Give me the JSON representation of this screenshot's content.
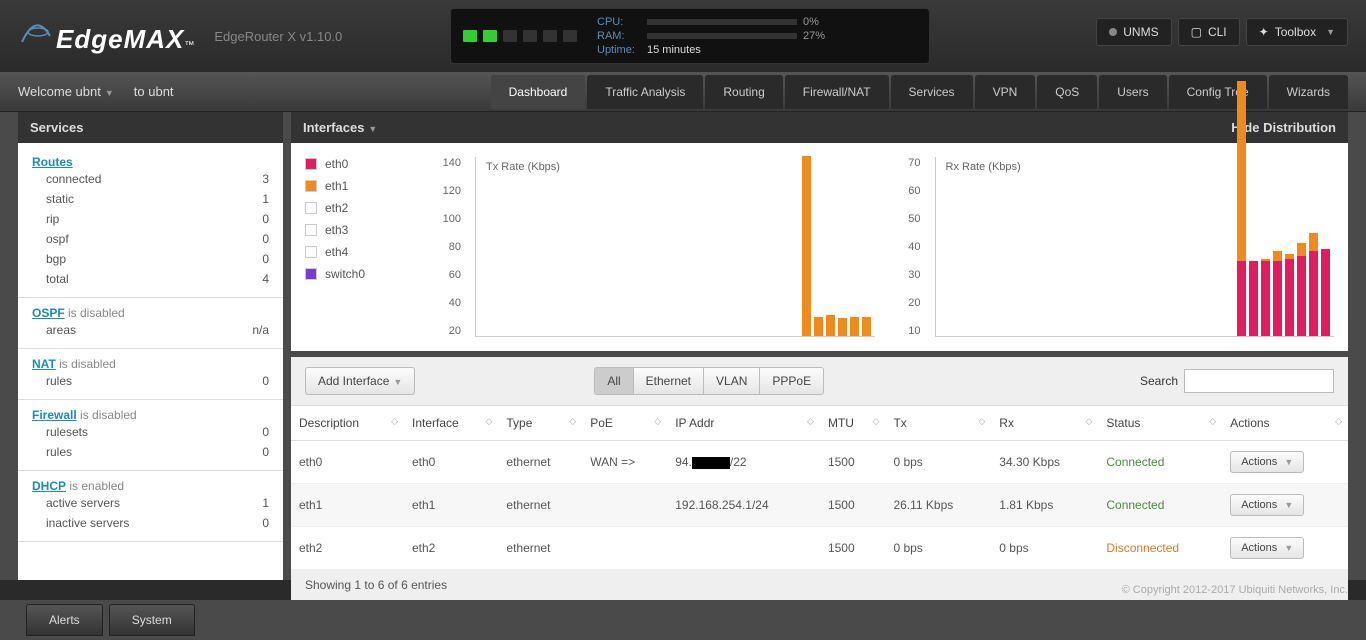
{
  "header": {
    "logo": "EdgeMAX",
    "model": "EdgeRouter X v1.10.0",
    "ports": [
      true,
      true,
      false,
      false,
      false,
      false
    ],
    "cpu_label": "CPU:",
    "cpu_pct": 0,
    "cpu_text": "0%",
    "ram_label": "RAM:",
    "ram_pct": 27,
    "ram_text": "27%",
    "uptime_label": "Uptime:",
    "uptime": "15 minutes",
    "unms": "UNMS",
    "cli": "CLI",
    "toolbox": "Toolbox"
  },
  "welcome": {
    "text": "Welcome ubnt",
    "to": "to ubnt"
  },
  "nav": [
    "Dashboard",
    "Traffic Analysis",
    "Routing",
    "Firewall/NAT",
    "Services",
    "VPN",
    "QoS",
    "Users",
    "Config Tree",
    "Wizards"
  ],
  "sidebar": {
    "title": "Services",
    "sections": [
      {
        "title": "Routes",
        "status": "",
        "rows": [
          [
            "connected",
            "3"
          ],
          [
            "static",
            "1"
          ],
          [
            "rip",
            "0"
          ],
          [
            "ospf",
            "0"
          ],
          [
            "bgp",
            "0"
          ],
          [
            "total",
            "4"
          ]
        ]
      },
      {
        "title": "OSPF",
        "status": " is disabled",
        "rows": [
          [
            "areas",
            "n/a"
          ]
        ]
      },
      {
        "title": "NAT",
        "status": " is disabled",
        "rows": [
          [
            "rules",
            "0"
          ]
        ]
      },
      {
        "title": "Firewall",
        "status": " is disabled",
        "rows": [
          [
            "rulesets",
            "0"
          ],
          [
            "rules",
            "0"
          ]
        ]
      },
      {
        "title": "DHCP",
        "status": " is enabled",
        "rows": [
          [
            "active servers",
            "1"
          ],
          [
            "inactive servers",
            "0"
          ]
        ]
      }
    ]
  },
  "interfaces": {
    "title": "Interfaces",
    "hide": "Hide Distribution",
    "legend": [
      {
        "name": "eth0",
        "color": "#e31b5f"
      },
      {
        "name": "eth1",
        "color": "#f08a1d"
      },
      {
        "name": "eth2",
        "color": "#ffffff"
      },
      {
        "name": "eth3",
        "color": "#ffffff"
      },
      {
        "name": "eth4",
        "color": "#ffffff"
      },
      {
        "name": "switch0",
        "color": "#7a3bcf"
      }
    ],
    "tx_label": "Tx Rate (Kbps)",
    "rx_label": "Rx Rate (Kbps)",
    "tx_ticks": [
      "140",
      "120",
      "100",
      "80",
      "60",
      "40",
      "20"
    ],
    "rx_ticks": [
      "70",
      "60",
      "50",
      "40",
      "30",
      "20",
      "10"
    ]
  },
  "chart_data": {
    "type": "bar",
    "charts": [
      {
        "title": "Tx Rate (Kbps)",
        "ylim": [
          0,
          140
        ],
        "series": [
          {
            "name": "eth1",
            "color": "#f08a1d",
            "values": [
              145,
              15,
              16,
              14,
              15,
              15
            ]
          }
        ]
      },
      {
        "title": "Rx Rate (Kbps)",
        "ylim": [
          0,
          70
        ],
        "series": [
          {
            "name": "eth0",
            "color": "#e31b5f",
            "values": [
              29,
              29,
              29,
              29,
              30,
              31,
              33,
              34
            ]
          },
          {
            "name": "eth1",
            "color": "#f08a1d",
            "values": [
              70,
              0,
              1,
              4,
              2,
              5,
              7,
              0
            ]
          }
        ]
      }
    ]
  },
  "table": {
    "add": "Add Interface",
    "filters": [
      "All",
      "Ethernet",
      "VLAN",
      "PPPoE"
    ],
    "search_label": "Search",
    "cols": [
      "Description",
      "Interface",
      "Type",
      "PoE",
      "IP Addr",
      "MTU",
      "Tx",
      "Rx",
      "Status",
      "Actions"
    ],
    "rows": [
      {
        "desc": "eth0",
        "iface": "eth0",
        "type": "ethernet",
        "poe": "WAN =>",
        "ip_pre": "94.",
        "ip_suf": "/22",
        "mtu": "1500",
        "tx": "0 bps",
        "rx": "34.30 Kbps",
        "status": "Connected",
        "redacted": true
      },
      {
        "desc": "eth1",
        "iface": "eth1",
        "type": "ethernet",
        "poe": "",
        "ip": "192.168.254.1/24",
        "mtu": "1500",
        "tx": "26.11 Kbps",
        "rx": "1.81 Kbps",
        "status": "Connected"
      },
      {
        "desc": "eth2",
        "iface": "eth2",
        "type": "ethernet",
        "poe": "",
        "ip": "",
        "mtu": "1500",
        "tx": "0 bps",
        "rx": "0 bps",
        "status": "Disconnected"
      }
    ],
    "footer": "Showing 1 to 6 of 6 entries",
    "action_label": "Actions"
  },
  "copyright": "© Copyright 2012-2017 Ubiquiti Networks, Inc.",
  "bottom": [
    "Alerts",
    "System"
  ]
}
